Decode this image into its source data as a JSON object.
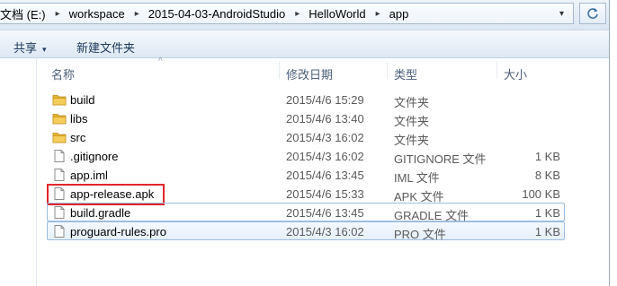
{
  "address": {
    "segments": [
      "文档 (E:)",
      "workspace",
      "2015-04-03-AndroidStudio",
      "HelloWorld",
      "app"
    ],
    "separator": "▸",
    "dropdown_glyph": "▾",
    "refresh_icon": "refresh-icon"
  },
  "toolbar": {
    "share_label": "共享",
    "share_caret": "▾",
    "new_folder_label": "新建文件夹"
  },
  "columns": {
    "name": "名称",
    "modified": "修改日期",
    "type": "类型",
    "size": "大小",
    "sort_arrow": "^",
    "sorted_by": "name"
  },
  "colors": {
    "highlight": "#e0262c",
    "folder": "#e8b535",
    "selection_border": "#9cbde0"
  },
  "files": [
    {
      "name": "build",
      "modified": "2015/4/6 15:29",
      "type": "文件夹",
      "size": "",
      "icon": "folder-icon"
    },
    {
      "name": "libs",
      "modified": "2015/4/6 13:40",
      "type": "文件夹",
      "size": "",
      "icon": "folder-icon"
    },
    {
      "name": "src",
      "modified": "2015/4/3 16:02",
      "type": "文件夹",
      "size": "",
      "icon": "folder-icon"
    },
    {
      "name": ".gitignore",
      "modified": "2015/4/3 16:02",
      "type": "GITIGNORE 文件",
      "size": "1 KB",
      "icon": "file-icon"
    },
    {
      "name": "app.iml",
      "modified": "2015/4/6 13:45",
      "type": "IML 文件",
      "size": "8 KB",
      "icon": "file-icon"
    },
    {
      "name": "app-release.apk",
      "modified": "2015/4/6 15:33",
      "type": "APK 文件",
      "size": "100 KB",
      "icon": "file-icon",
      "highlighted": true
    },
    {
      "name": "build.gradle",
      "modified": "2015/4/6 13:45",
      "type": "GRADLE 文件",
      "size": "1 KB",
      "icon": "file-icon",
      "state": "focus"
    },
    {
      "name": "proguard-rules.pro",
      "modified": "2015/4/3 16:02",
      "type": "PRO 文件",
      "size": "1 KB",
      "icon": "file-icon",
      "state": "hover"
    }
  ]
}
